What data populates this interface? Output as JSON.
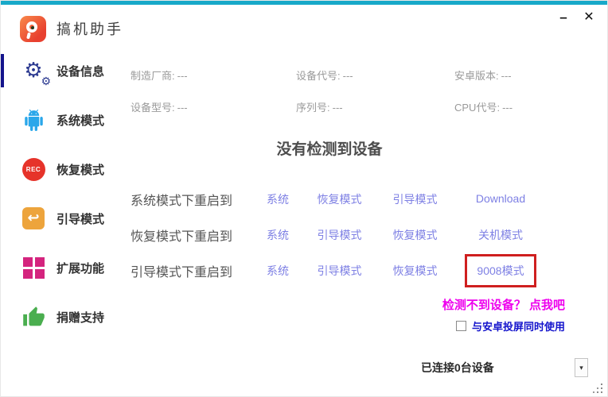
{
  "window": {
    "title": "搞机助手",
    "minimize_label": "–",
    "close_label": "✕"
  },
  "sidebar": {
    "items": [
      {
        "label": "设备信息",
        "icon": "gears-icon",
        "active": true
      },
      {
        "label": "系统模式",
        "icon": "android-icon",
        "active": false
      },
      {
        "label": "恢复模式",
        "icon": "rec-icon",
        "active": false
      },
      {
        "label": "引导模式",
        "icon": "back-arrow-icon",
        "active": false
      },
      {
        "label": "扩展功能",
        "icon": "grid-icon",
        "active": false
      },
      {
        "label": "捐赠支持",
        "icon": "thumbs-up-icon",
        "active": false
      }
    ]
  },
  "icons": {
    "gear_glyph": "⚙",
    "gear_small_glyph": "⚙",
    "rec_label": "REC",
    "back_arrow_glyph": "↩",
    "dropdown_arrow_glyph": "▾"
  },
  "device_info": {
    "fields": [
      {
        "label": "制造厂商:",
        "value": "---"
      },
      {
        "label": "设备代号:",
        "value": "---"
      },
      {
        "label": "安卓版本:",
        "value": "---"
      },
      {
        "label": "设备型号:",
        "value": "---"
      },
      {
        "label": "序列号:",
        "value": "---"
      },
      {
        "label": "CPU代号:",
        "value": "---"
      }
    ]
  },
  "status_heading": "没有检测到设备",
  "reboot_rows": [
    {
      "label": "系统模式下重启到",
      "options": [
        "系统",
        "恢复模式",
        "引导模式",
        "Download"
      ]
    },
    {
      "label": "恢复模式下重启到",
      "options": [
        "系统",
        "引导模式",
        "恢复模式",
        "关机模式"
      ]
    },
    {
      "label": "引导模式下重启到",
      "options": [
        "系统",
        "引导模式",
        "恢复模式",
        "9008模式"
      ],
      "highlighted_option": "9008模式"
    }
  ],
  "help_link": "检测不到设备？ 点我吧",
  "mirror_checkbox": {
    "label": "与安卓投屏同时使用",
    "checked": false
  },
  "device_dropdown": {
    "value": "已连接0台设备"
  },
  "colors": {
    "accent_top": "#18a9c9",
    "link": "#7e80e4",
    "highlight_box": "#cf1f1f",
    "help_link": "#ee00ee",
    "checkbox_label": "#1414cc",
    "active_indicator": "#14148c",
    "logo_gradient_start": "#f98a4b",
    "logo_gradient_end": "#e8402f",
    "icon_gear": "#2b3990",
    "icon_android": "#2aa7ea",
    "icon_rec": "#e6332a",
    "icon_back": "#eda43c",
    "icon_grid": "#d4247e",
    "icon_thumb": "#4aae4f"
  }
}
